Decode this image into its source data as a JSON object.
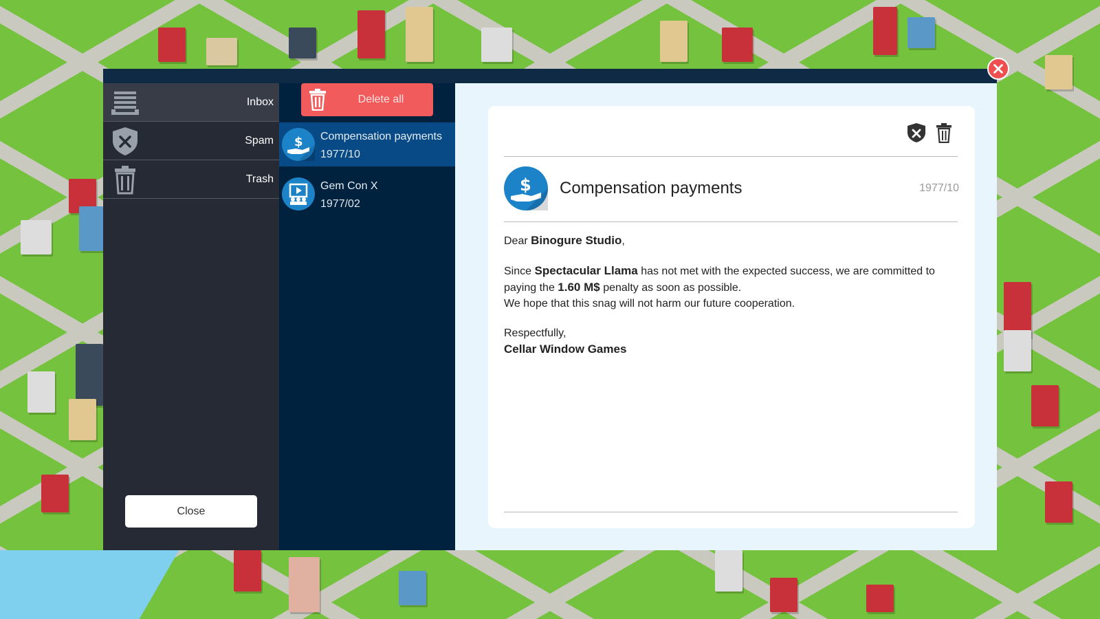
{
  "folders": {
    "items": [
      {
        "label": "Inbox",
        "icon": "inbox-icon"
      },
      {
        "label": "Spam",
        "icon": "spam-shield-icon"
      },
      {
        "label": "Trash",
        "icon": "trash-icon"
      }
    ],
    "close_label": "Close"
  },
  "list": {
    "delete_all_label": "Delete all",
    "messages": [
      {
        "subject": "Compensation payments",
        "date": "1977/10",
        "icon": "money-hand-icon"
      },
      {
        "subject": "Gem Con X",
        "date": "1977/02",
        "icon": "convention-icon"
      }
    ]
  },
  "reader": {
    "title": "Compensation payments",
    "date": "1977/10",
    "greeting": "Dear",
    "recipient": "Binogure Studio",
    "greeting_end": ",",
    "p1_start": "Since",
    "game": "Spectacular Llama",
    "p1_mid": "has not met with the expected success, we are committed to paying the",
    "amount": "1.60 M$",
    "p1_end": "penalty as soon as possible.",
    "p2": "We hope that this snag will not harm our future cooperation.",
    "signoff": "Respectfully,",
    "sender": "Cellar Window Games"
  },
  "colors": {
    "accent_red": "#f25b5b",
    "selected_blue": "#074a86",
    "avatar_blue": "#1d83c9"
  }
}
